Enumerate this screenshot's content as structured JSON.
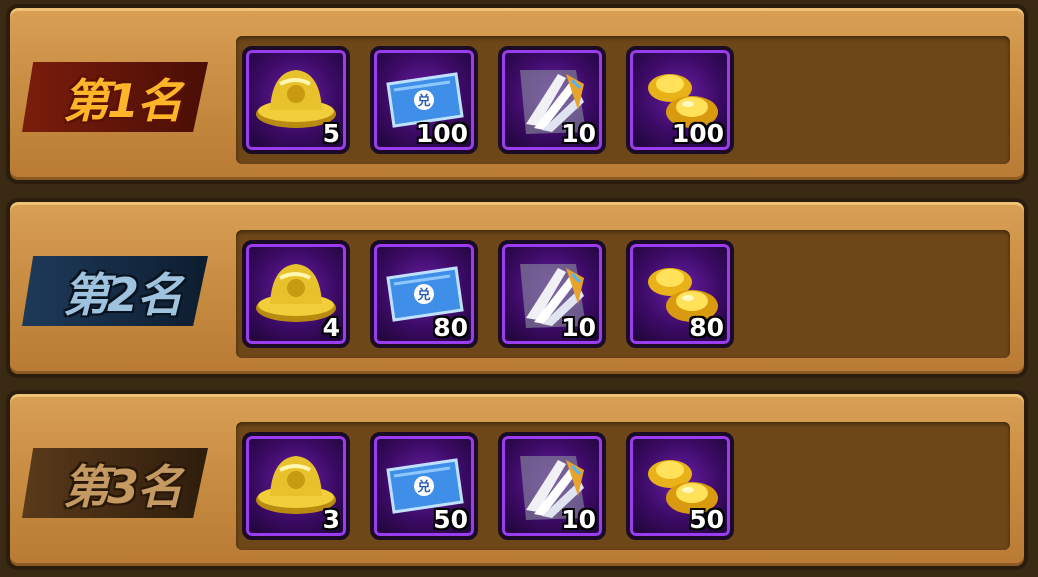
{
  "rows": [
    {
      "rank_label": "第1名",
      "rewards": [
        {
          "icon": "golden-hat-icon",
          "qty": "5"
        },
        {
          "icon": "blue-ticket-icon",
          "qty": "100"
        },
        {
          "icon": "feather-wing-puzzle-icon",
          "qty": "10"
        },
        {
          "icon": "gold-ingot-icon",
          "qty": "100"
        }
      ]
    },
    {
      "rank_label": "第2名",
      "rewards": [
        {
          "icon": "golden-hat-icon",
          "qty": "4"
        },
        {
          "icon": "blue-ticket-icon",
          "qty": "80"
        },
        {
          "icon": "feather-wing-puzzle-icon",
          "qty": "10"
        },
        {
          "icon": "gold-ingot-icon",
          "qty": "80"
        }
      ]
    },
    {
      "rank_label": "第3名",
      "rewards": [
        {
          "icon": "golden-hat-icon",
          "qty": "3"
        },
        {
          "icon": "blue-ticket-icon",
          "qty": "50"
        },
        {
          "icon": "feather-wing-puzzle-icon",
          "qty": "10"
        },
        {
          "icon": "gold-ingot-icon",
          "qty": "50"
        }
      ]
    }
  ],
  "colors": {
    "panel": "#c98d43",
    "tray": "#6e4719",
    "slot_border": "#9a3cf0",
    "rank1": "#ffb52a",
    "rank2": "#9fc2de",
    "rank3": "#c49a62"
  }
}
